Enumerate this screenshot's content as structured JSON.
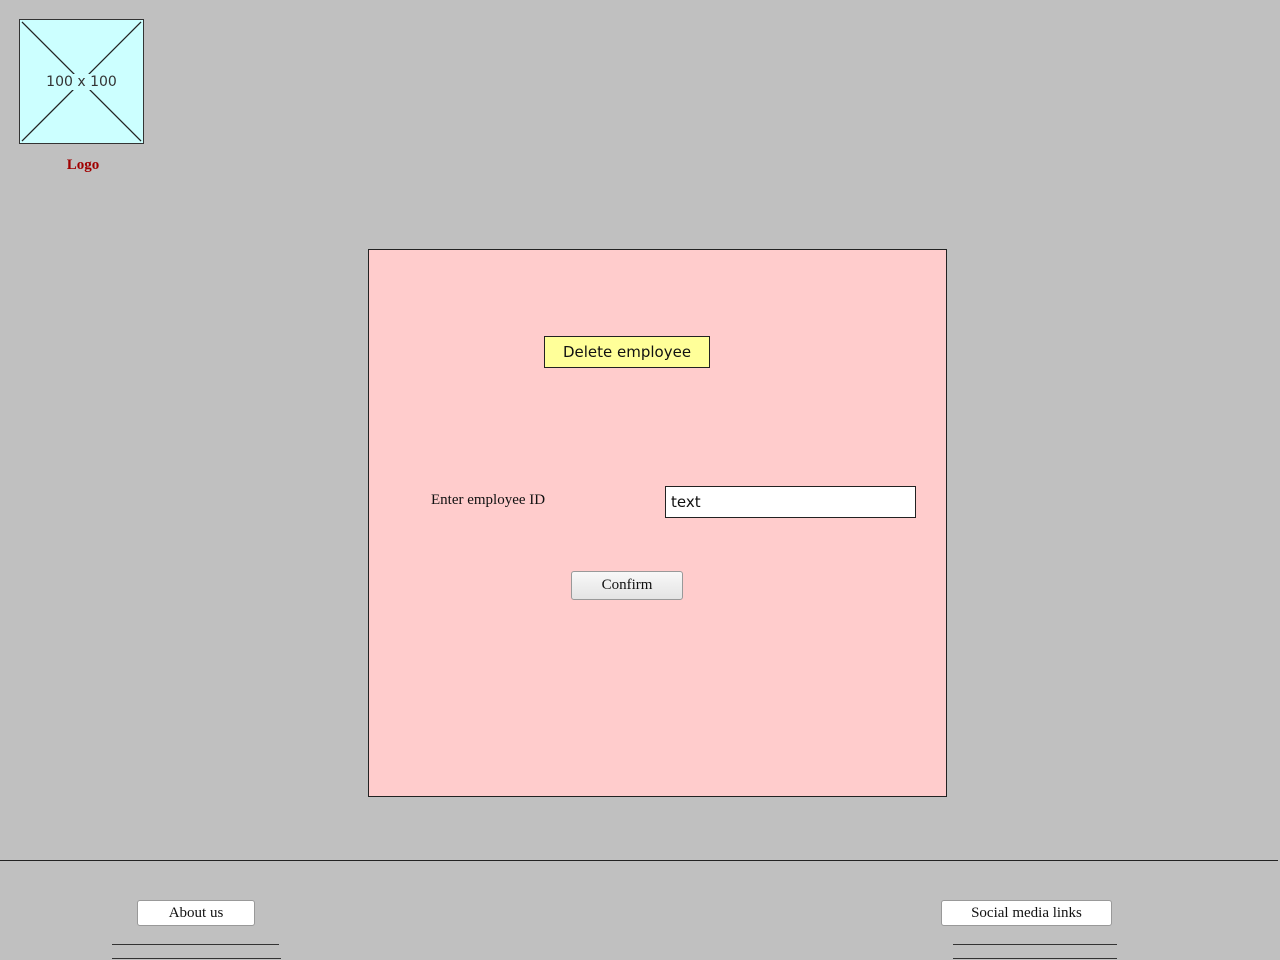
{
  "header": {
    "logo_placeholder_text": "100 x 100",
    "logo_label": "Logo"
  },
  "main": {
    "title": "Delete employee",
    "employee_id_label": "Enter employee ID",
    "employee_id_value": "text",
    "confirm_label": "Confirm"
  },
  "footer": {
    "about_label": "About us",
    "social_label": "Social media links"
  },
  "colors": {
    "background": "#c0c0c0",
    "panel": "#ffcccc",
    "title_box": "#ffff99",
    "logo_fill": "#ccffff",
    "logo_label": "#a00000"
  },
  "icons": {
    "logo": "image-placeholder-icon"
  }
}
